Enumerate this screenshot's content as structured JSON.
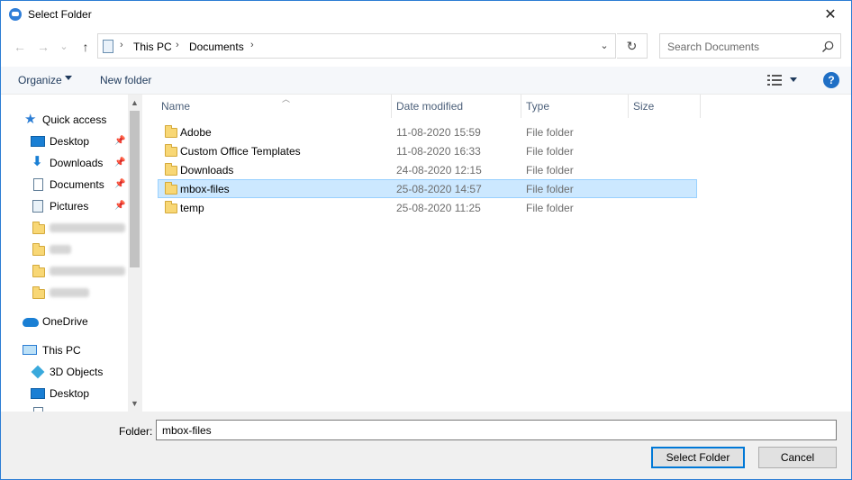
{
  "window": {
    "title": "Select Folder",
    "close_glyph": "✕"
  },
  "nav": {
    "back_glyph": "←",
    "forward_glyph": "→",
    "recent_glyph": "⌄",
    "up_glyph": "↑",
    "breadcrumbs": [
      "This PC",
      "Documents"
    ],
    "crumb_sep": "›",
    "dropdown_glyph": "⌄",
    "refresh_glyph": "↻",
    "search_placeholder": "Search Documents"
  },
  "toolbar": {
    "organize_label": "Organize",
    "new_folder_label": "New folder",
    "help_glyph": "?"
  },
  "sidebar": {
    "quick_access": "Quick access",
    "pinned": [
      {
        "label": "Desktop",
        "icon": "desktop-icon"
      },
      {
        "label": "Downloads",
        "icon": "downloads-icon"
      },
      {
        "label": "Documents",
        "icon": "documents-icon"
      },
      {
        "label": "Pictures",
        "icon": "pictures-icon"
      }
    ],
    "pin_glyph": "📌",
    "onedrive": "OneDrive",
    "this_pc": "This PC",
    "this_pc_items": [
      {
        "label": "3D Objects",
        "icon": "3d-objects-icon"
      },
      {
        "label": "Desktop",
        "icon": "desktop-icon"
      }
    ]
  },
  "columns": {
    "name": "Name",
    "date": "Date modified",
    "type": "Type",
    "size": "Size"
  },
  "files": [
    {
      "name": "Adobe",
      "date": "11-08-2020 15:59",
      "type": "File folder",
      "selected": false
    },
    {
      "name": "Custom Office Templates",
      "date": "11-08-2020 16:33",
      "type": "File folder",
      "selected": false
    },
    {
      "name": "Downloads",
      "date": "24-08-2020 12:15",
      "type": "File folder",
      "selected": false
    },
    {
      "name": "mbox-files",
      "date": "25-08-2020 14:57",
      "type": "File folder",
      "selected": true
    },
    {
      "name": "temp",
      "date": "25-08-2020 11:25",
      "type": "File folder",
      "selected": false
    }
  ],
  "footer": {
    "folder_label": "Folder:",
    "folder_value": "mbox-files",
    "select_button": "Select Folder",
    "cancel_button": "Cancel"
  },
  "colors": {
    "accent": "#0078d7",
    "selection": "#cce8ff",
    "folder": "#f8d775"
  }
}
